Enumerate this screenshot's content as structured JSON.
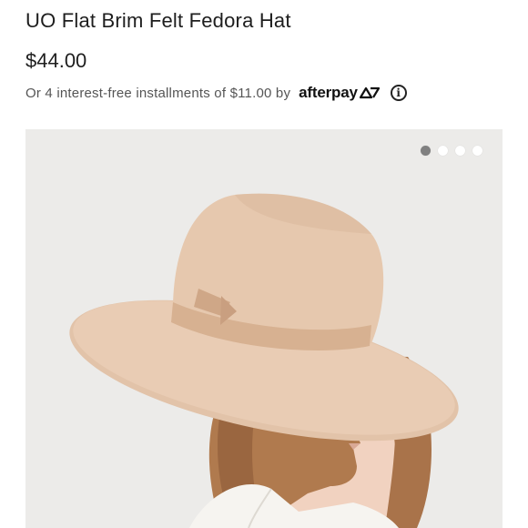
{
  "product": {
    "title": "UO Flat Brim Felt Fedora Hat",
    "price": "$44.00"
  },
  "afterpay": {
    "installments_text": "Or 4 interest-free installments of $11.00 by",
    "logo_text": "afterpay",
    "info_icon": "info-circle-icon",
    "info_glyph": "i"
  },
  "carousel": {
    "image_alt": "Model wearing a beige flat brim felt fedora hat",
    "slide_count": 4,
    "active_slide": 1
  },
  "colors": {
    "hat": "#e5c6ad",
    "band": "#d9b496",
    "background": "#ecebe9",
    "afterpay_mark": "#111111"
  }
}
